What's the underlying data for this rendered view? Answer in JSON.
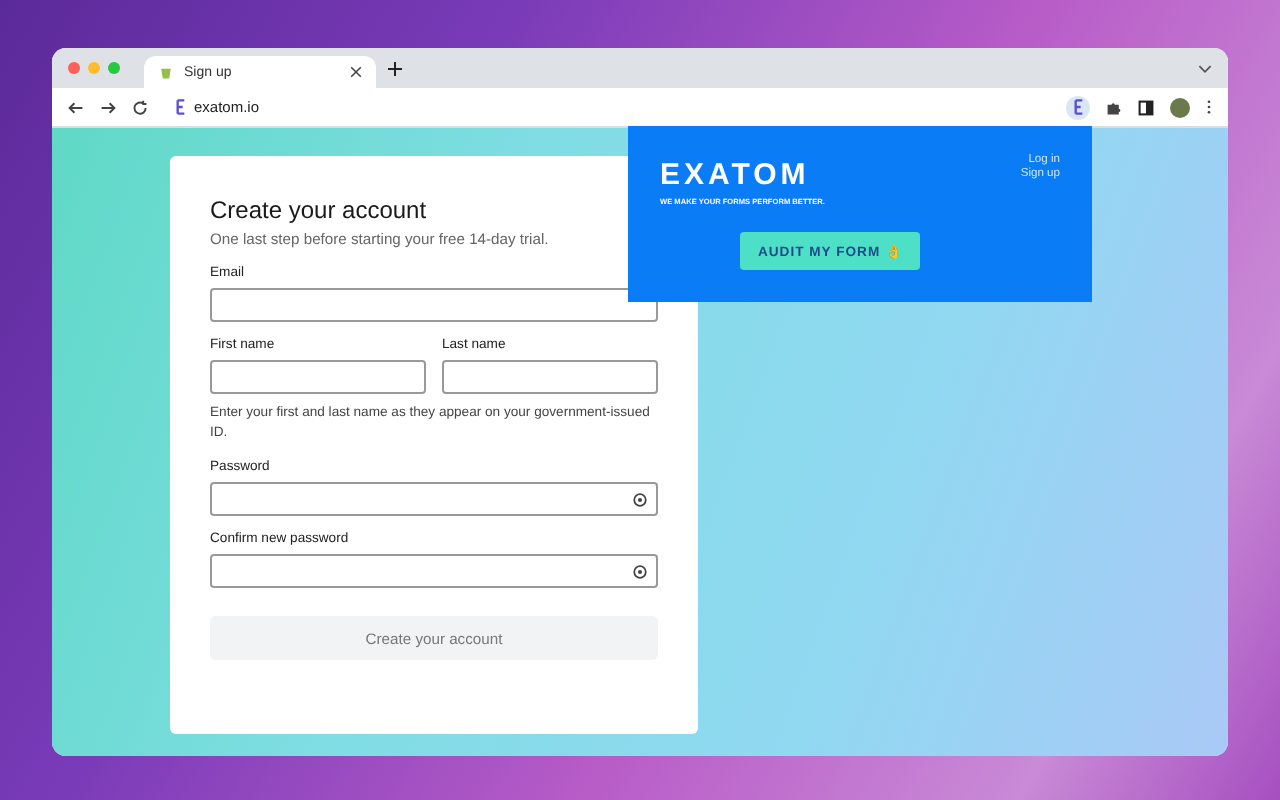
{
  "browser": {
    "tab_title": "Sign up",
    "url": "exatom.io"
  },
  "form": {
    "title": "Create your account",
    "subtitle": "One last step before starting your free 14-day trial.",
    "rows": [
      {
        "fields": [
          {
            "label": "Email",
            "kind": "text"
          }
        ]
      },
      {
        "fields": [
          {
            "label": "First name",
            "kind": "text"
          },
          {
            "label": "Last name",
            "kind": "text"
          }
        ],
        "hint": "Enter your first and last name as they appear on your government-issued ID."
      },
      {
        "fields": [
          {
            "label": "Password",
            "kind": "password"
          }
        ]
      },
      {
        "fields": [
          {
            "label": "Confirm new password",
            "kind": "password"
          }
        ]
      }
    ],
    "submit": {
      "label": "Create your account",
      "disabled": true
    }
  },
  "popup": {
    "logo": "EXATOM",
    "tagline": "WE MAKE YOUR FORMS PERFORM BETTER.",
    "links": [
      "Log in",
      "Sign up"
    ],
    "button": "AUDIT MY FORM 👌"
  }
}
